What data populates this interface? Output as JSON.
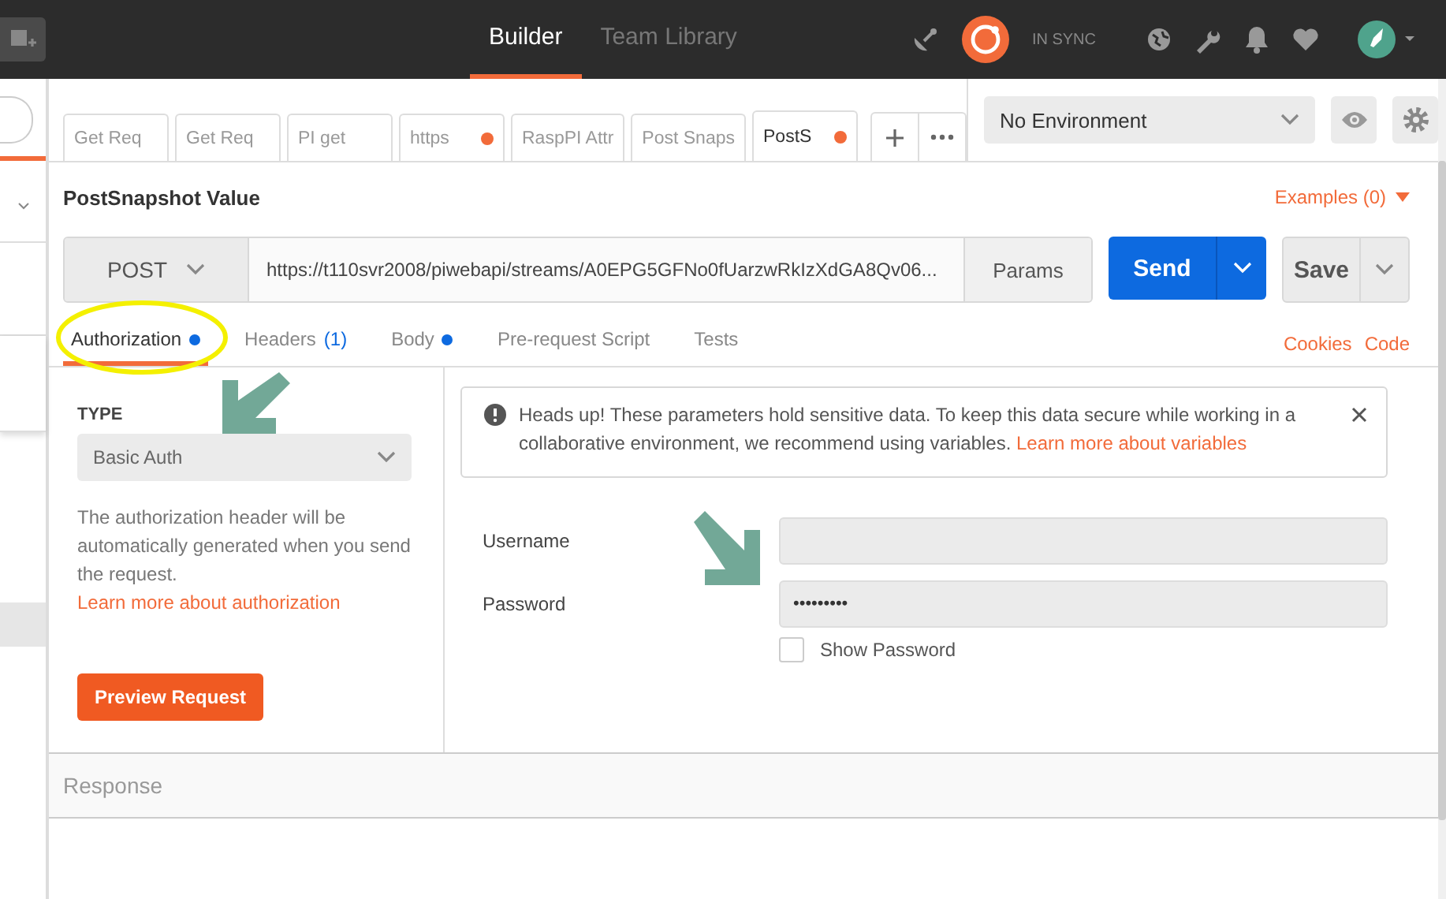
{
  "top_bar": {
    "nav": [
      {
        "label": "Builder",
        "selected": true
      },
      {
        "label": "Team Library",
        "selected": false
      }
    ],
    "sync_status": "IN SYNC"
  },
  "request_tabs": [
    {
      "label": "Get Req",
      "modified": false,
      "selected": false
    },
    {
      "label": "Get Req",
      "modified": false,
      "selected": false
    },
    {
      "label": "PI get",
      "modified": false,
      "selected": false
    },
    {
      "label": "https",
      "modified": true,
      "selected": false
    },
    {
      "label": "RaspPI Attr",
      "modified": false,
      "selected": false
    },
    {
      "label": "Post Snaps",
      "modified": false,
      "selected": false
    },
    {
      "label": "PostS",
      "modified": true,
      "selected": true
    }
  ],
  "environment": {
    "value": "No Environment"
  },
  "request": {
    "name": "PostSnapshot Value",
    "examples": "Examples (0)",
    "method": "POST",
    "url": "https://t110svr2008/piwebapi/streams/A0EPG5GFNo0fUarzwRkIzXdGA8Qv06...",
    "params": "Params",
    "send": "Send",
    "save": "Save"
  },
  "sub_tabs": [
    {
      "label": "Authorization",
      "selected": true,
      "dot": true
    },
    {
      "label": "Headers",
      "count": "(1)",
      "selected": false,
      "dot": false
    },
    {
      "label": "Body",
      "selected": false,
      "dot": true
    },
    {
      "label": "Pre-request Script",
      "selected": false,
      "dot": false
    },
    {
      "label": "Tests",
      "selected": false,
      "dot": false
    }
  ],
  "sub_tab_links": [
    "Cookies",
    "Code"
  ],
  "auth": {
    "type_label": "TYPE",
    "type": "Basic Auth",
    "description": "The authorization header will be automatically generated when you send the request. ",
    "description_link": "Learn more about authorization",
    "preview_button": "Preview Request"
  },
  "alert": {
    "text": "Heads up! These parameters hold sensitive data. To keep this data secure while working in a collaborative environment, we recommend using variables. ",
    "link": "Learn more about variables"
  },
  "fields": [
    {
      "label": "Username"
    },
    {
      "label": "Password",
      "value": "•••••••••"
    }
  ],
  "show_password": {
    "label": "Show Password",
    "checked": false
  },
  "response": {
    "title": "Response"
  }
}
